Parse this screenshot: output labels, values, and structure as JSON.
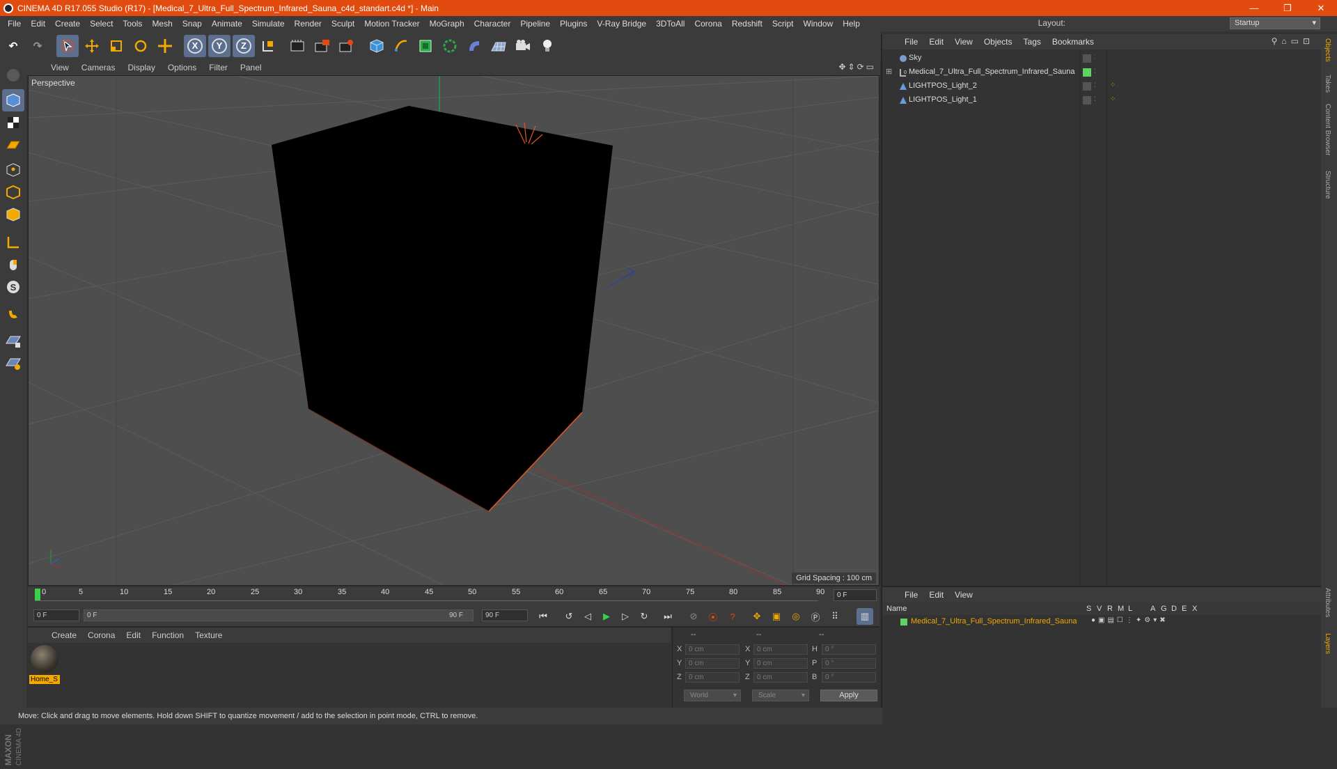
{
  "titlebar": {
    "title": "CINEMA 4D R17.055 Studio (R17) - [Medical_7_Ultra_Full_Spectrum_Infrared_Sauna_c4d_standart.c4d *] - Main",
    "minimize": "—",
    "restore": "❐",
    "close": "✕"
  },
  "menubar": {
    "items": [
      "File",
      "Edit",
      "Create",
      "Select",
      "Tools",
      "Mesh",
      "Snap",
      "Animate",
      "Simulate",
      "Render",
      "Sculpt",
      "Motion Tracker",
      "MoGraph",
      "Character",
      "Pipeline",
      "Plugins",
      "V-Ray Bridge",
      "3DToAll",
      "Corona",
      "Redshift",
      "Script",
      "Window",
      "Help"
    ],
    "layout_label": "Layout:",
    "layout_value": "Startup"
  },
  "toolbar": {
    "x_label": "X",
    "y_label": "Y",
    "z_label": "Z"
  },
  "viewport": {
    "menu": [
      "View",
      "Cameras",
      "Display",
      "Options",
      "Filter",
      "Panel"
    ],
    "label": "Perspective",
    "grid_spacing": "Grid Spacing : 100 cm"
  },
  "timeline": {
    "ticks": [
      "0",
      "5",
      "10",
      "15",
      "20",
      "25",
      "30",
      "35",
      "40",
      "45",
      "50",
      "55",
      "60",
      "65",
      "70",
      "75",
      "80",
      "85",
      "90"
    ],
    "current_frame": "0 F"
  },
  "transport": {
    "start_field": "0 F",
    "range_start": "0 F",
    "range_end": "90 F",
    "end_field": "90 F"
  },
  "materials": {
    "menu": [
      "Create",
      "Corona",
      "Edit",
      "Function",
      "Texture"
    ],
    "items": [
      {
        "name": "Home_S"
      }
    ]
  },
  "coordinates": {
    "headers": [
      "--",
      "--",
      "--"
    ],
    "rows": [
      {
        "a": "X",
        "av": "0 cm",
        "b": "X",
        "bv": "0 cm",
        "c": "H",
        "cv": "0 °"
      },
      {
        "a": "Y",
        "av": "0 cm",
        "b": "Y",
        "bv": "0 cm",
        "c": "P",
        "cv": "0 °"
      },
      {
        "a": "Z",
        "av": "0 cm",
        "b": "Z",
        "bv": "0 cm",
        "c": "B",
        "cv": "0 °"
      }
    ],
    "world": "World",
    "scale": "Scale",
    "apply": "Apply"
  },
  "objects": {
    "menu": [
      "File",
      "Edit",
      "View",
      "Objects",
      "Tags",
      "Bookmarks"
    ],
    "rows": [
      {
        "name": "Sky",
        "icon": "sky-icon"
      },
      {
        "name": "Medical_7_Ultra_Full_Spectrum_Infrared_Sauna",
        "icon": "null-object-icon"
      },
      {
        "name": "LIGHTPOS_Light_2",
        "icon": "light-icon"
      },
      {
        "name": "LIGHTPOS_Light_1",
        "icon": "light-icon"
      }
    ]
  },
  "layers": {
    "menu": [
      "File",
      "Edit",
      "View"
    ],
    "col_name": "Name",
    "cols": [
      "S",
      "V",
      "R",
      "M",
      "L",
      "A",
      "G",
      "D",
      "E",
      "X"
    ],
    "rows": [
      {
        "name": "Medical_7_Ultra_Full_Spectrum_Infrared_Sauna",
        "color": "#5fd35f"
      }
    ]
  },
  "right_tabs": [
    "Objects",
    "Takes",
    "Content Browser",
    "Structure",
    "Attributes",
    "Layers"
  ],
  "status": "Move: Click and drag to move elements. Hold down SHIFT to quantize movement / add to the selection in point mode, CTRL to remove.",
  "branding": {
    "maxon": "MAXON",
    "product": "CINEMA 4D"
  },
  "colors": {
    "accent": "#e24b10",
    "highlight": "#f2a900",
    "selected_layer": "#f2a900"
  }
}
